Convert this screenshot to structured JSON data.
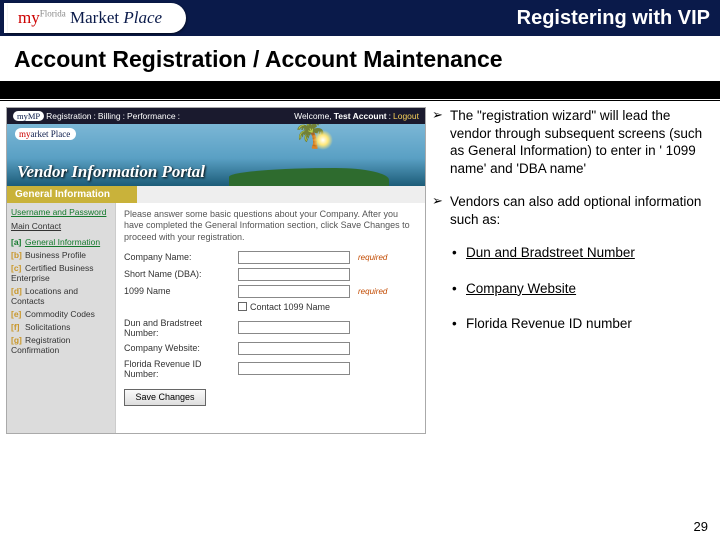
{
  "topbar": {
    "logo_my": "my",
    "logo_market": "arket",
    "logo_place": "Place",
    "title": "Registering with VIP"
  },
  "section_title": "Account Registration / Account Maintenance",
  "bullets": [
    "The \"registration wizard\" will lead the vendor through subsequent screens (such as General Information) to enter in ' 1099 name' and 'DBA name'",
    "Vendors can also add optional information such as:"
  ],
  "sub_bullets": [
    "Dun and Bradstreet Number",
    "Company Website",
    "Florida Revenue ID number"
  ],
  "shot": {
    "nav_tabs": {
      "reg": "Registration",
      "bill": "Billing",
      "perf": "Performance"
    },
    "welcome_prefix": "Welcome,",
    "welcome_name": "Test Account",
    "logout": "Logout",
    "mini_logo_my": "my",
    "mini_logo_rest": "arket Place",
    "hero_title": "Vendor Information Portal",
    "section_tab": "General Information",
    "nav": {
      "current": "Username and Password",
      "main_contact": "Main Contact",
      "steps_tag": [
        "[a]",
        "[b]",
        "[c]",
        "[d]",
        "[e]",
        "[f]",
        "[g]"
      ],
      "steps": [
        "General Information",
        "Business Profile",
        "Certified Business Enterprise",
        "Locations and Contacts",
        "Commodity Codes",
        "Solicitations",
        "Registration Confirmation"
      ]
    },
    "intro": "Please answer some basic questions about your Company. After you have completed the General Information section, click Save Changes to proceed with your registration.",
    "labels": {
      "company": "Company Name:",
      "short": "Short Name (DBA):",
      "t1099": "1099 Name",
      "contact_cb": "Contact 1099 Name",
      "duns": "Dun and Bradstreet Number:",
      "website": "Company Website:",
      "frid": "Florida Revenue ID Number:"
    },
    "required": "required",
    "save_btn": "Save Changes"
  },
  "page_number": "29"
}
